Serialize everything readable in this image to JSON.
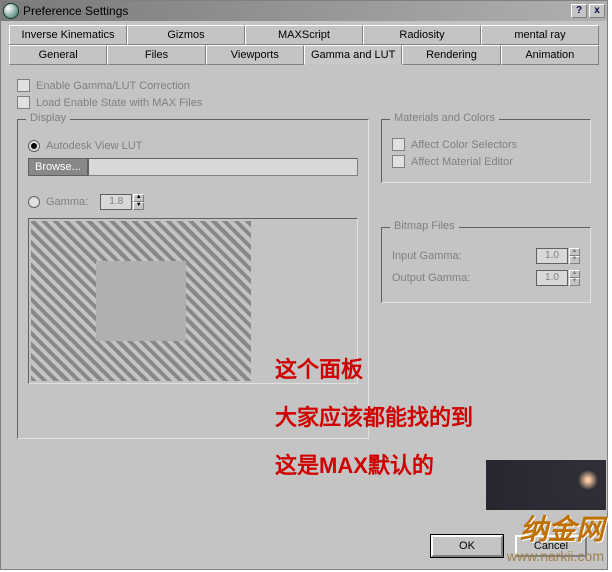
{
  "window": {
    "title": "Preference Settings",
    "help_btn": "?",
    "close_btn": "x"
  },
  "tabs_row1": [
    "Inverse Kinematics",
    "Gizmos",
    "MAXScript",
    "Radiosity",
    "mental ray"
  ],
  "tabs_row2": [
    "General",
    "Files",
    "Viewports",
    "Gamma and LUT",
    "Rendering",
    "Animation"
  ],
  "active_tab": "Gamma and LUT",
  "checks": {
    "enable_gamma": "Enable Gamma/LUT Correction",
    "load_enable": "Load Enable State with MAX Files"
  },
  "display": {
    "label": "Display",
    "autodesk_lut": "Autodesk View LUT",
    "browse": "Browse...",
    "gamma_label": "Gamma:",
    "gamma_value": "1.8"
  },
  "materials": {
    "label": "Materials and Colors",
    "affect_color": "Affect Color Selectors",
    "affect_material": "Affect Material Editor"
  },
  "bitmap": {
    "label": "Bitmap Files",
    "input_label": "Input Gamma:",
    "input_value": "1.0",
    "output_label": "Output Gamma:",
    "output_value": "1.0"
  },
  "buttons": {
    "ok": "OK",
    "cancel": "Cancel"
  },
  "annotations": {
    "line1": "这个面板",
    "line2": "大家应该都能找的到",
    "line3": "这是MAX默认的"
  },
  "watermark": {
    "logo": "纳金网",
    "url": "www.narkii.com"
  }
}
